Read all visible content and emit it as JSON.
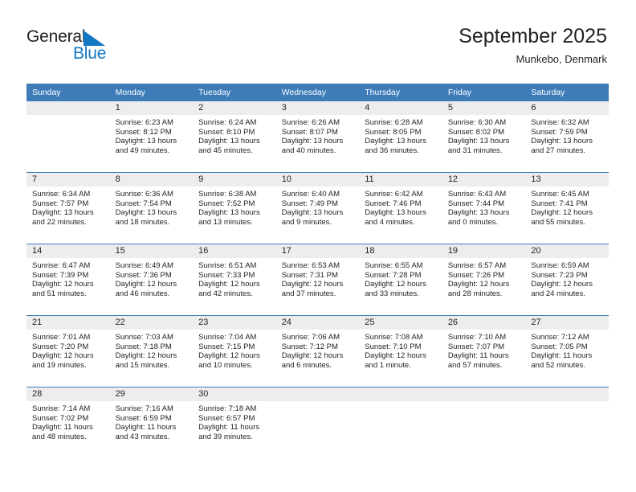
{
  "brand": {
    "name_part1": "General",
    "name_part2": "Blue",
    "triangle_color": "#1277c4",
    "text_color": "#231f20"
  },
  "header": {
    "title": "September 2025",
    "subtitle": "Munkebo, Denmark"
  },
  "theme": {
    "header_bg": "#3d7cb8",
    "header_text": "#ffffff",
    "daynum_bg": "#ededed",
    "cell_bg": "#ffffff",
    "text": "#231f20",
    "separator": "#3d7cb8"
  },
  "calendar": {
    "weekdays": [
      "Sunday",
      "Monday",
      "Tuesday",
      "Wednesday",
      "Thursday",
      "Friday",
      "Saturday"
    ],
    "labels": {
      "sunrise": "Sunrise:",
      "sunset": "Sunset:",
      "daylight": "Daylight:"
    },
    "weeks": [
      [
        {
          "blank": true,
          "day": "",
          "sunrise": "",
          "sunset": "",
          "daylight_line1": "",
          "daylight_line2": ""
        },
        {
          "blank": false,
          "day": "1",
          "sunrise": "Sunrise: 6:23 AM",
          "sunset": "Sunset: 8:12 PM",
          "daylight_line1": "Daylight: 13 hours",
          "daylight_line2": "and 49 minutes."
        },
        {
          "blank": false,
          "day": "2",
          "sunrise": "Sunrise: 6:24 AM",
          "sunset": "Sunset: 8:10 PM",
          "daylight_line1": "Daylight: 13 hours",
          "daylight_line2": "and 45 minutes."
        },
        {
          "blank": false,
          "day": "3",
          "sunrise": "Sunrise: 6:26 AM",
          "sunset": "Sunset: 8:07 PM",
          "daylight_line1": "Daylight: 13 hours",
          "daylight_line2": "and 40 minutes."
        },
        {
          "blank": false,
          "day": "4",
          "sunrise": "Sunrise: 6:28 AM",
          "sunset": "Sunset: 8:05 PM",
          "daylight_line1": "Daylight: 13 hours",
          "daylight_line2": "and 36 minutes."
        },
        {
          "blank": false,
          "day": "5",
          "sunrise": "Sunrise: 6:30 AM",
          "sunset": "Sunset: 8:02 PM",
          "daylight_line1": "Daylight: 13 hours",
          "daylight_line2": "and 31 minutes."
        },
        {
          "blank": false,
          "day": "6",
          "sunrise": "Sunrise: 6:32 AM",
          "sunset": "Sunset: 7:59 PM",
          "daylight_line1": "Daylight: 13 hours",
          "daylight_line2": "and 27 minutes."
        }
      ],
      [
        {
          "blank": false,
          "day": "7",
          "sunrise": "Sunrise: 6:34 AM",
          "sunset": "Sunset: 7:57 PM",
          "daylight_line1": "Daylight: 13 hours",
          "daylight_line2": "and 22 minutes."
        },
        {
          "blank": false,
          "day": "8",
          "sunrise": "Sunrise: 6:36 AM",
          "sunset": "Sunset: 7:54 PM",
          "daylight_line1": "Daylight: 13 hours",
          "daylight_line2": "and 18 minutes."
        },
        {
          "blank": false,
          "day": "9",
          "sunrise": "Sunrise: 6:38 AM",
          "sunset": "Sunset: 7:52 PM",
          "daylight_line1": "Daylight: 13 hours",
          "daylight_line2": "and 13 minutes."
        },
        {
          "blank": false,
          "day": "10",
          "sunrise": "Sunrise: 6:40 AM",
          "sunset": "Sunset: 7:49 PM",
          "daylight_line1": "Daylight: 13 hours",
          "daylight_line2": "and 9 minutes."
        },
        {
          "blank": false,
          "day": "11",
          "sunrise": "Sunrise: 6:42 AM",
          "sunset": "Sunset: 7:46 PM",
          "daylight_line1": "Daylight: 13 hours",
          "daylight_line2": "and 4 minutes."
        },
        {
          "blank": false,
          "day": "12",
          "sunrise": "Sunrise: 6:43 AM",
          "sunset": "Sunset: 7:44 PM",
          "daylight_line1": "Daylight: 13 hours",
          "daylight_line2": "and 0 minutes."
        },
        {
          "blank": false,
          "day": "13",
          "sunrise": "Sunrise: 6:45 AM",
          "sunset": "Sunset: 7:41 PM",
          "daylight_line1": "Daylight: 12 hours",
          "daylight_line2": "and 55 minutes."
        }
      ],
      [
        {
          "blank": false,
          "day": "14",
          "sunrise": "Sunrise: 6:47 AM",
          "sunset": "Sunset: 7:39 PM",
          "daylight_line1": "Daylight: 12 hours",
          "daylight_line2": "and 51 minutes."
        },
        {
          "blank": false,
          "day": "15",
          "sunrise": "Sunrise: 6:49 AM",
          "sunset": "Sunset: 7:36 PM",
          "daylight_line1": "Daylight: 12 hours",
          "daylight_line2": "and 46 minutes."
        },
        {
          "blank": false,
          "day": "16",
          "sunrise": "Sunrise: 6:51 AM",
          "sunset": "Sunset: 7:33 PM",
          "daylight_line1": "Daylight: 12 hours",
          "daylight_line2": "and 42 minutes."
        },
        {
          "blank": false,
          "day": "17",
          "sunrise": "Sunrise: 6:53 AM",
          "sunset": "Sunset: 7:31 PM",
          "daylight_line1": "Daylight: 12 hours",
          "daylight_line2": "and 37 minutes."
        },
        {
          "blank": false,
          "day": "18",
          "sunrise": "Sunrise: 6:55 AM",
          "sunset": "Sunset: 7:28 PM",
          "daylight_line1": "Daylight: 12 hours",
          "daylight_line2": "and 33 minutes."
        },
        {
          "blank": false,
          "day": "19",
          "sunrise": "Sunrise: 6:57 AM",
          "sunset": "Sunset: 7:26 PM",
          "daylight_line1": "Daylight: 12 hours",
          "daylight_line2": "and 28 minutes."
        },
        {
          "blank": false,
          "day": "20",
          "sunrise": "Sunrise: 6:59 AM",
          "sunset": "Sunset: 7:23 PM",
          "daylight_line1": "Daylight: 12 hours",
          "daylight_line2": "and 24 minutes."
        }
      ],
      [
        {
          "blank": false,
          "day": "21",
          "sunrise": "Sunrise: 7:01 AM",
          "sunset": "Sunset: 7:20 PM",
          "daylight_line1": "Daylight: 12 hours",
          "daylight_line2": "and 19 minutes."
        },
        {
          "blank": false,
          "day": "22",
          "sunrise": "Sunrise: 7:03 AM",
          "sunset": "Sunset: 7:18 PM",
          "daylight_line1": "Daylight: 12 hours",
          "daylight_line2": "and 15 minutes."
        },
        {
          "blank": false,
          "day": "23",
          "sunrise": "Sunrise: 7:04 AM",
          "sunset": "Sunset: 7:15 PM",
          "daylight_line1": "Daylight: 12 hours",
          "daylight_line2": "and 10 minutes."
        },
        {
          "blank": false,
          "day": "24",
          "sunrise": "Sunrise: 7:06 AM",
          "sunset": "Sunset: 7:12 PM",
          "daylight_line1": "Daylight: 12 hours",
          "daylight_line2": "and 6 minutes."
        },
        {
          "blank": false,
          "day": "25",
          "sunrise": "Sunrise: 7:08 AM",
          "sunset": "Sunset: 7:10 PM",
          "daylight_line1": "Daylight: 12 hours",
          "daylight_line2": "and 1 minute."
        },
        {
          "blank": false,
          "day": "26",
          "sunrise": "Sunrise: 7:10 AM",
          "sunset": "Sunset: 7:07 PM",
          "daylight_line1": "Daylight: 11 hours",
          "daylight_line2": "and 57 minutes."
        },
        {
          "blank": false,
          "day": "27",
          "sunrise": "Sunrise: 7:12 AM",
          "sunset": "Sunset: 7:05 PM",
          "daylight_line1": "Daylight: 11 hours",
          "daylight_line2": "and 52 minutes."
        }
      ],
      [
        {
          "blank": false,
          "day": "28",
          "sunrise": "Sunrise: 7:14 AM",
          "sunset": "Sunset: 7:02 PM",
          "daylight_line1": "Daylight: 11 hours",
          "daylight_line2": "and 48 minutes."
        },
        {
          "blank": false,
          "day": "29",
          "sunrise": "Sunrise: 7:16 AM",
          "sunset": "Sunset: 6:59 PM",
          "daylight_line1": "Daylight: 11 hours",
          "daylight_line2": "and 43 minutes."
        },
        {
          "blank": false,
          "day": "30",
          "sunrise": "Sunrise: 7:18 AM",
          "sunset": "Sunset: 6:57 PM",
          "daylight_line1": "Daylight: 11 hours",
          "daylight_line2": "and 39 minutes."
        },
        {
          "blank": true,
          "day": "",
          "sunrise": "",
          "sunset": "",
          "daylight_line1": "",
          "daylight_line2": ""
        },
        {
          "blank": true,
          "day": "",
          "sunrise": "",
          "sunset": "",
          "daylight_line1": "",
          "daylight_line2": ""
        },
        {
          "blank": true,
          "day": "",
          "sunrise": "",
          "sunset": "",
          "daylight_line1": "",
          "daylight_line2": ""
        },
        {
          "blank": true,
          "day": "",
          "sunrise": "",
          "sunset": "",
          "daylight_line1": "",
          "daylight_line2": ""
        }
      ]
    ]
  }
}
